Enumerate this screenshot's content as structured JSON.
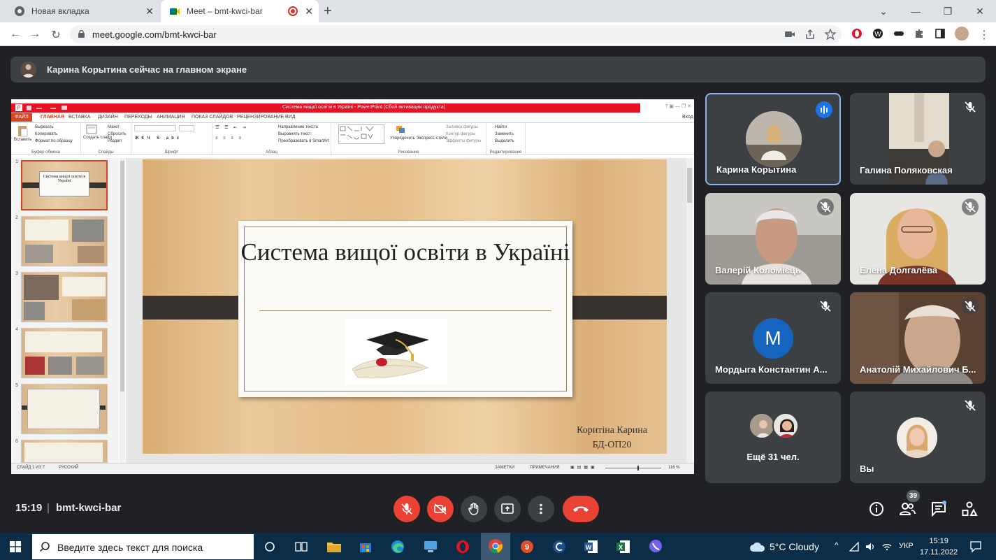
{
  "browser": {
    "tabs": [
      {
        "label": "Новая вкладка"
      },
      {
        "label": "Meet – bmt-kwci-bar"
      }
    ],
    "url": "meet.google.com/bmt-kwci-bar"
  },
  "banner": {
    "text": "Карина Корытина сейчас на главном экране"
  },
  "powerpoint": {
    "window_title": "Система вищої освіти в Україні - PowerPoint (Сбой активации продукта)",
    "tabs": [
      "ФАЙЛ",
      "ГЛАВНАЯ",
      "ВСТАВКА",
      "ДИЗАЙН",
      "ПЕРЕХОДЫ",
      "АНИМАЦИЯ",
      "ПОКАЗ СЛАЙДОВ",
      "РЕЦЕНЗИРОВАНИЕ",
      "ВИД"
    ],
    "signin": "Вход",
    "ribbon": {
      "paste": "Вставить",
      "cut": "Вырезать",
      "copy": "Копировать",
      "format_painter": "Формат по образцу",
      "clipboard_group": "Буфер обмена",
      "new_slide": "Создать слайд",
      "layout": "Макет",
      "reset": "Сбросить",
      "section": "Раздел",
      "slides_group": "Слайды",
      "font_group": "Шрифт",
      "text_direction": "Направление текста",
      "align_text": "Выровнять текст",
      "convert_smartart": "Преобразовать в SmartArt",
      "paragraph_group": "Абзац",
      "arrange": "Упорядочить",
      "quick_styles": "Экспресс-стили",
      "shape_fill": "Заливка фигуры",
      "shape_outline": "Контур фигуры",
      "shape_effects": "Эффекты фигуры",
      "drawing_group": "Рисование",
      "find": "Найти",
      "replace": "Заменить",
      "select": "Выделить",
      "editing_group": "Редактирование"
    },
    "thumbnails": [
      {
        "num": "1",
        "title": "Система вищої освіти в Україні"
      },
      {
        "num": "2"
      },
      {
        "num": "3"
      },
      {
        "num": "4"
      },
      {
        "num": "5"
      },
      {
        "num": "6"
      }
    ],
    "slide": {
      "title": "Система вищої освіти в Україні",
      "author_line1": "Коритіна Карина",
      "author_line2": "БД-ОП20"
    },
    "status": {
      "slide_info": "СЛАЙД 1 ИЗ 7",
      "language": "РУССКИЙ",
      "notes": "ЗАМЕТКИ",
      "comments": "ПРИМЕЧАНИЯ",
      "zoom": "116 %"
    }
  },
  "participants": [
    {
      "name": "Карина Корытина",
      "speaking": true
    },
    {
      "name": "Галина Поляковская",
      "muted": true
    },
    {
      "name": "Валерій Коломієць",
      "muted": true
    },
    {
      "name": "Елена Долгалёва",
      "muted": true
    },
    {
      "name": "Мордыга Константин А...",
      "initial": "M",
      "muted": true
    },
    {
      "name": "Анатолій Михайлович Б...",
      "muted": true
    },
    {
      "name": "Ещё 31 чел."
    },
    {
      "name": "Вы",
      "muted": true
    }
  ],
  "meeting": {
    "time": "15:19",
    "separator": "|",
    "code": "bmt-kwci-bar",
    "people_count": "39"
  },
  "taskbar": {
    "search_placeholder": "Введите здесь текст для поиска",
    "weather": "5°C  Cloudy",
    "lang": "УКР",
    "time": "15:19",
    "date": "17.11.2022"
  },
  "colors": {
    "leave": "#ea4335",
    "accent": "#8ab4f8",
    "ppt": "#d24726"
  }
}
